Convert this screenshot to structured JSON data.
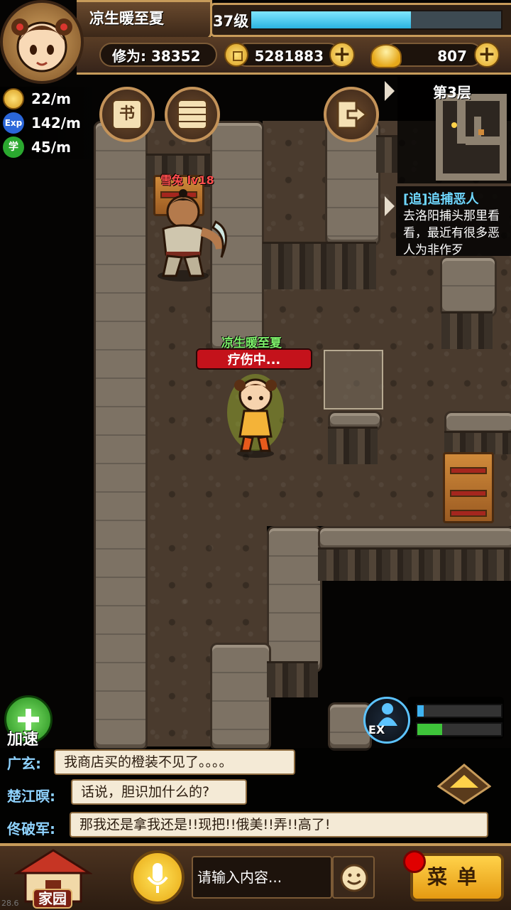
{
  "player": {
    "name": "凉生暖至夏",
    "level_label": "37级",
    "level_progress": 0.64,
    "cultivation_label": "修为:",
    "cultivation_value": "38352",
    "coins": "5281883",
    "ingots": "807",
    "status": "疗伤中..."
  },
  "rates": [
    {
      "icon": "coin-icon",
      "value": "22/m"
    },
    {
      "icon": "exp-icon",
      "icon_text": "Exp",
      "value": "142/m"
    },
    {
      "icon": "learn-icon",
      "icon_text": "学",
      "value": "45/m"
    }
  ],
  "toolbar": {
    "book_icon_text": "书"
  },
  "map": {
    "floor_label": "第3层"
  },
  "quest": {
    "title": "[追]追捕恶人",
    "description": "去洛阳捕头那里看看，最近有很多恶人为非作歹"
  },
  "enemy": {
    "label": "雪兔 lv18"
  },
  "speed_up": {
    "label": "加速"
  },
  "exp_panel": {
    "icon_text": "EX",
    "bar1_progress": 0.08,
    "bar2_progress": 0.3
  },
  "chat": [
    {
      "name": "广玄:",
      "message": "我商店买的橙装不见了。。。。"
    },
    {
      "name": "楚江暝:",
      "message": "话说，胆识加什么的?"
    },
    {
      "name": "佟破军:",
      "message": "那我还是拿我还是!!现把!!俄美!!弄!!高了!"
    }
  ],
  "bottom": {
    "home_label": "家园",
    "input_placeholder": "请输入内容...",
    "menu_label": "菜单"
  },
  "debug": {
    "fps": "28.6"
  },
  "colors": {
    "accent_gold": "#c79b5a",
    "status_red": "#c4121b",
    "player_name_green": "#7ef06a",
    "quest_title_blue": "#6fd8ff"
  }
}
